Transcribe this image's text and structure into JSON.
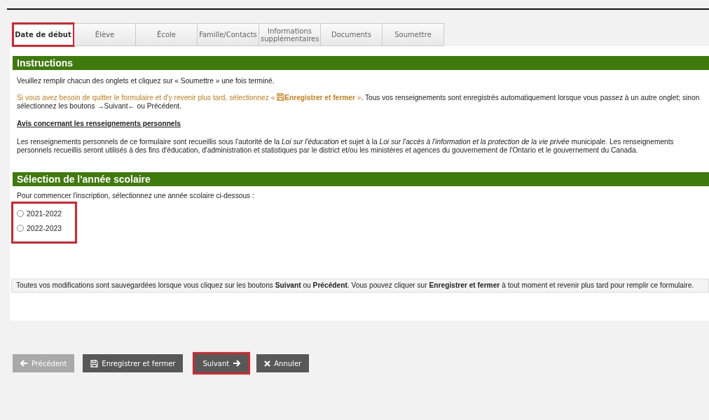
{
  "tabs": [
    {
      "label": "Date de début",
      "selected": true,
      "highlighted": true
    },
    {
      "label": "Élève",
      "selected": false,
      "highlighted": false
    },
    {
      "label": "École",
      "selected": false,
      "highlighted": false
    },
    {
      "label": "Famille/Contacts",
      "selected": false,
      "highlighted": false
    },
    {
      "label": "Informations supplémentaires",
      "selected": false,
      "highlighted": false
    },
    {
      "label": "Documents",
      "selected": false,
      "highlighted": false
    },
    {
      "label": "Soumettre",
      "selected": false,
      "highlighted": false
    }
  ],
  "instructions": {
    "heading": "Instructions",
    "intro": "Veuillez remplir chacun des onglets et cliquez sur « Soumettre » une fois terminé.",
    "save_note": [
      {
        "kind": "text",
        "accent": true,
        "text": "Si vous avez besoin de quitter le formulaire et d'y revenir plus tard, sélectionnez « "
      },
      {
        "kind": "icon"
      },
      {
        "kind": "text",
        "accent": true,
        "text": "**Enregistrer et fermer** »"
      },
      {
        "kind": "text",
        "accent": false,
        "text": ". Tous vos renseignements sont enregistrés automatiquement lorsque vous passez à un autre onglet; sinon sélectionnez les boutons →Suivant← ou Précédent."
      }
    ],
    "privacy_title": "Avis concernant les renseignements personnels",
    "privacy_text": "Les renseignements personnels de ce formulaire sont recueillis sous l'autorité de la *Loi sur l'éducation* et sujet à la *Loi sur l'accès à l'information et la protection de la vie privée* municipale. Les renseignements personnels recueillis seront utilisés à des fins d'éducation, d'administration et statistiques par le district et/ou les ministères et agences du gouvernement de l'Ontario et le gouvernement du Canada."
  },
  "school_year": {
    "heading": "Sélection de l'année scolaire",
    "prompt": "Pour commencer l'inscription, sélectionnez une année scolaire ci-dessous :",
    "highlighted": true,
    "options": [
      {
        "label": "2021-2022",
        "selected": false
      },
      {
        "label": "2022-2023",
        "selected": false
      }
    ]
  },
  "footer_note": "Toutes vos modifications sont sauvegardées lorsque vous cliquez sur les boutons **Suivant** ou **Précédent**. Vous pouvez cliquer sur **Enregistrer et fermer** à tout moment et revenir plus tard pour remplir ce formulaire.",
  "buttons": [
    {
      "kind": "previous",
      "label": "Précédent",
      "disabled": true,
      "highlighted": false
    },
    {
      "kind": "save",
      "label": "Enregistrer et fermer",
      "disabled": false,
      "highlighted": false
    },
    {
      "kind": "next",
      "label": "Suivant",
      "disabled": false,
      "highlighted": true
    },
    {
      "kind": "cancel",
      "label": "Annuler",
      "disabled": false,
      "highlighted": false
    }
  ]
}
